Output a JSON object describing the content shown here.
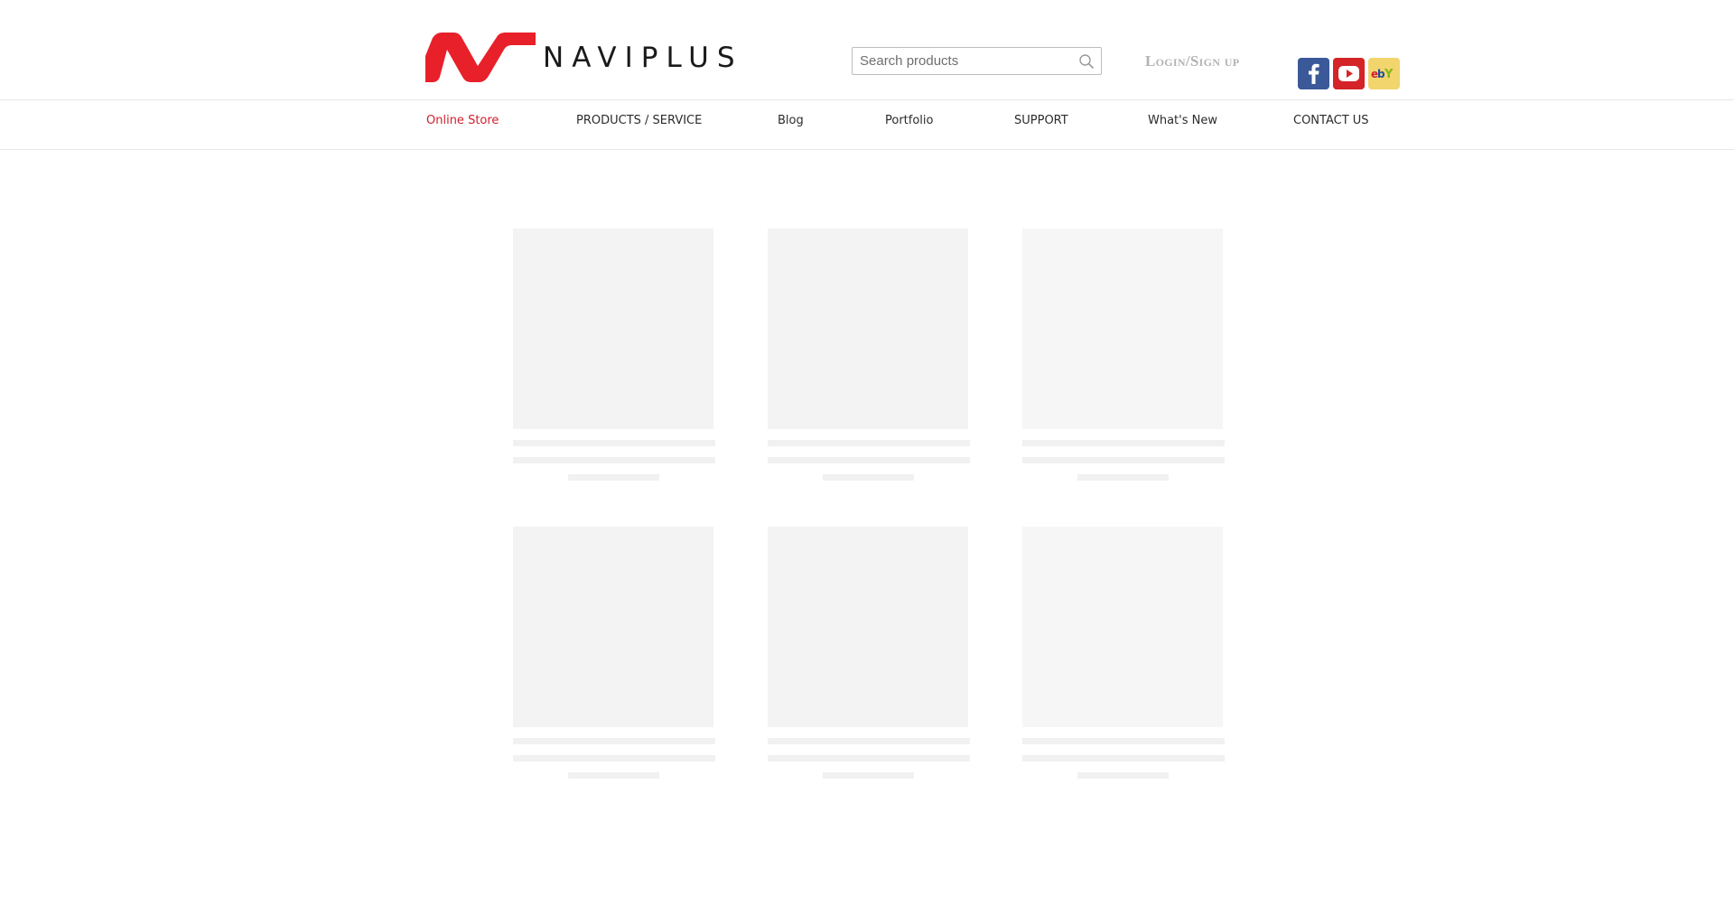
{
  "brand": {
    "name": "NAVIPLUS",
    "logo_color": "#e8202a"
  },
  "search": {
    "placeholder": "Search products",
    "icon": "search-icon"
  },
  "auth": {
    "login_label": "Login/Sign up"
  },
  "social": [
    {
      "name": "facebook",
      "icon": "facebook-icon",
      "color": "#3b5998"
    },
    {
      "name": "youtube",
      "icon": "youtube-icon",
      "color": "#d42428"
    },
    {
      "name": "ebay",
      "icon": "ebay-icon",
      "color": "#f3d56e"
    }
  ],
  "nav": {
    "items": [
      {
        "label": "Online Store",
        "active": true
      },
      {
        "label": "PRODUCTS / SERVICE"
      },
      {
        "label": "Blog"
      },
      {
        "label": "Portfolio"
      },
      {
        "label": "SUPPORT"
      },
      {
        "label": "What's New"
      },
      {
        "label": "CONTACT US"
      }
    ],
    "active_color": "#d0202e"
  },
  "products": {
    "state": "loading",
    "placeholder_count": 6
  }
}
